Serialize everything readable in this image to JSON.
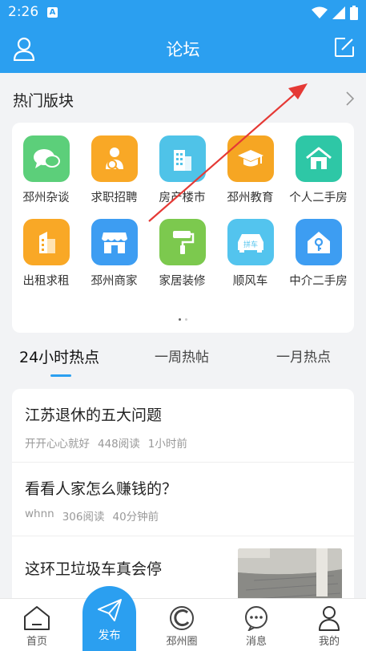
{
  "status_bar": {
    "time": "2:26",
    "notification_badge": "A"
  },
  "header": {
    "title": "论坛"
  },
  "hot_boards": {
    "title": "热门版块",
    "items": [
      {
        "label": "邳州杂谈",
        "icon": "chat-bubbles-icon",
        "color": "#5ccf7a"
      },
      {
        "label": "求职招聘",
        "icon": "job-search-icon",
        "color": "#f9a826"
      },
      {
        "label": "房产楼市",
        "icon": "building-icon",
        "color": "#4fc3e8"
      },
      {
        "label": "邳州教育",
        "icon": "graduation-cap-icon",
        "color": "#f6a623"
      },
      {
        "label": "个人二手房",
        "icon": "house-icon",
        "color": "#2ec7a6"
      },
      {
        "label": "出租求租",
        "icon": "office-building-icon",
        "color": "#f9a826"
      },
      {
        "label": "邳州商家",
        "icon": "storefront-icon",
        "color": "#3d9df2"
      },
      {
        "label": "家居装修",
        "icon": "paint-roller-icon",
        "color": "#7cc94e"
      },
      {
        "label": "顺风车",
        "icon": "car-icon",
        "color": "#53c4ee"
      },
      {
        "label": "中介二手房",
        "icon": "house-key-icon",
        "color": "#3d9df2"
      }
    ]
  },
  "tabs": [
    {
      "label": "24小时热点",
      "active": true
    },
    {
      "label": "一周热帖",
      "active": false
    },
    {
      "label": "一月热点",
      "active": false
    }
  ],
  "posts": [
    {
      "title": "江苏退休的五大问题",
      "author": "开开心心就好",
      "views": "448阅读",
      "time": "1小时前"
    },
    {
      "title": "看看人家怎么赚钱的？",
      "author": "whnn",
      "views": "306阅读",
      "time": "40分钟前"
    },
    {
      "title": "这环卫垃圾车真会停"
    }
  ],
  "car_icon_text": "拼车",
  "bottom_nav": {
    "home": "首页",
    "publish": "发布",
    "circle": "邳州圈",
    "messages": "消息",
    "mine": "我的"
  },
  "colors": {
    "primary": "#2b9ff0",
    "annotation": "#e53935"
  }
}
